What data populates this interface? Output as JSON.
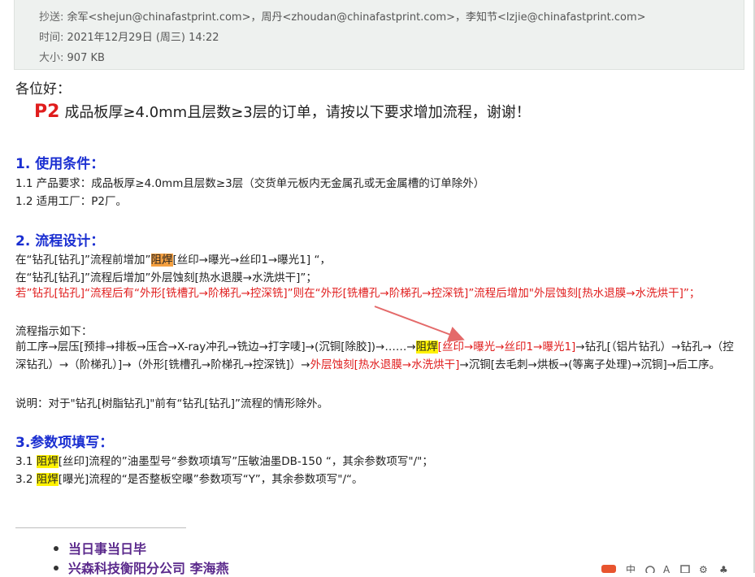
{
  "header": {
    "cc_label": "抄送:",
    "cc_value": "余军<shejun@chinafastprint.com>，周丹<zhoudan@chinafastprint.com>，李知节<lzjie@chinafastprint.com>",
    "time_label": "时间:",
    "time_value": "2021年12月29日 (周三) 14:22",
    "size_label": "大小:",
    "size_value": "907 KB"
  },
  "greeting": "各位好：",
  "intro": {
    "p2": "P2",
    "text": "成品板厚≥4.0mm且层数≥3层的订单，请按以下要求增加流程，谢谢！"
  },
  "section1": {
    "title": "1. 使用条件：",
    "line1": "1.1  产品要求：成品板厚≥4.0mm且层数≥3层（交货单元板内无金属孔或无金属槽的订单除外）",
    "line2": "1.2  适用工厂：P2厂。"
  },
  "section2": {
    "title": "2. 流程设计：",
    "l1a": "在“钻孔[钻孔]”流程前增加”",
    "l1hl": "阻焊",
    "l1b": "[丝印→曝光→丝印1→曝光1] “，",
    "l2": "在“钻孔[钻孔]”流程后增加”外层蚀刻[热水退膜→水洗烘干]”；",
    "l3": "若”钻孔[钻孔]“流程后有“外形[铣槽孔→阶梯孔→控深铣]”则在“外形[铣槽孔→阶梯孔→控深铣]”流程后增加\"外层蚀刻[热水退膜→水洗烘干]”；",
    "flow_label": "流程指示如下：",
    "flow_a": "前工序→层压[预排→排板→压合→X-ray冲孔→铣边→打字唛]→(沉铜[除胶])→……→",
    "flow_hl": "阻焊",
    "flow_red1": "[丝印→曝光→丝印1→曝光1]",
    "flow_b": "→钻孔[（铝片钻孔）→钻孔→（控深钻孔）→（阶梯孔）]→（外形[铣槽孔→阶梯孔→控深铣]）→",
    "flow_red2": "外层蚀刻[热水退膜→水洗烘干]",
    "flow_c": "→沉铜[去毛刺→烘板→(等离子处理)→沉铜]→后工序。",
    "note": "说明：对于\"钻孔[树脂钻孔]\"前有“钻孔[钻孔]”流程的情形除外。"
  },
  "section3": {
    "title": "3.参数项填写：",
    "l1num": "3.1 ",
    "l1hl": "阻焊",
    "l1text": "[丝印]流程的”油墨型号“参数项填写”压敏油墨DB-150 “，其余参数项写\"/\"；",
    "l2num": "3.2 ",
    "l2hl": "阻焊",
    "l2text": "[曝光]流程的“是否整板空曝”参数项写“Y”，其余参数项写\"/“。"
  },
  "signature": {
    "line1": "当日事当日毕",
    "line2": "兴森科技衡阳分公司   李海燕"
  },
  "colors": {
    "title_blue": "#1b2fd1",
    "red": "#e01d1d",
    "highlight_orange": "#f5a040",
    "highlight_yellow": "#fff200",
    "signature_purple": "#5b2a8c",
    "header_bg": "#eef1ef"
  }
}
